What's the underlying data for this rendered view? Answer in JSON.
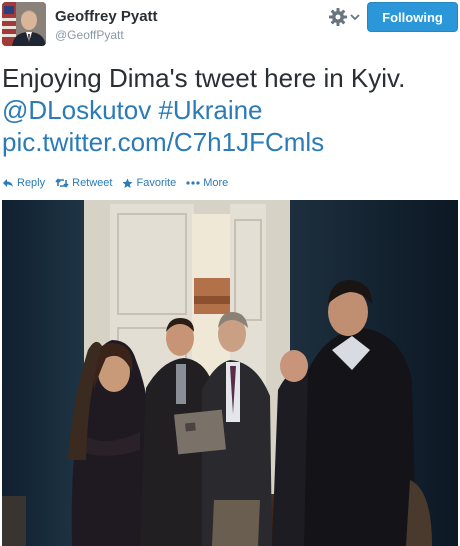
{
  "tweet": {
    "author_name": "Geoffrey Pyatt",
    "author_handle": "@GeoffPyatt",
    "follow_label": "Following",
    "text_plain": "Enjoying Dima's tweet here in Kyiv.",
    "mention": "@DLoskutov",
    "hashtag": "#Ukraine",
    "pic_link": "pic.twitter.com/C7h1JFCmls"
  },
  "actions": {
    "reply": "Reply",
    "retweet": "Retweet",
    "favorite": "Favorite",
    "more": "More"
  },
  "icons": {
    "gear": "gear-icon",
    "reply": "reply-icon",
    "retweet": "retweet-icon",
    "favorite": "star-icon",
    "more": "more-dots-icon"
  },
  "colors": {
    "link": "#2b7bb9",
    "follow_button": "#2b97d8",
    "name": "#292f33",
    "handle": "#8899a6"
  }
}
